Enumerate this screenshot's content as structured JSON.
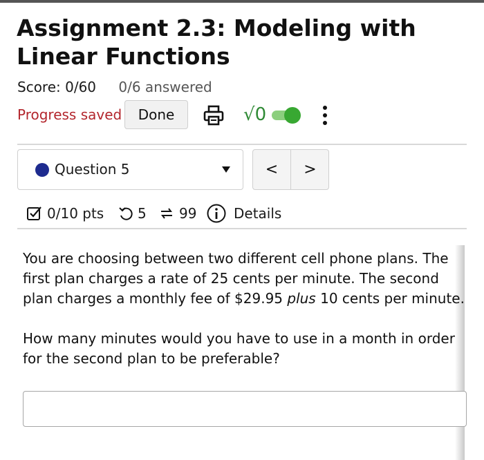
{
  "header": {
    "title": "Assignment 2.3: Modeling with Linear Functions",
    "score": "Score: 0/60",
    "answered": "0/6 answered"
  },
  "actions": {
    "progress_status": "Progress saved",
    "done_label": "Done",
    "print_icon": "printer-icon",
    "math_icon": "√0",
    "math_toggle_on": true,
    "accent_color": "#38a832",
    "more_icon": "kebab-menu-icon"
  },
  "question_nav": {
    "selected": "Question 5",
    "status_color": "#1e2b8f",
    "prev_label": "<",
    "next_label": ">"
  },
  "meta": {
    "points": "0/10 pts",
    "attempts": "5",
    "versions": "99",
    "details_label": "Details"
  },
  "question": {
    "paragraph1_a": "You are choosing between two different cell phone plans. The first plan charges a rate of 25 cents per minute. The second plan charges a monthly fee of $29.95 ",
    "paragraph1_em": "plus",
    "paragraph1_b": " 10 cents per minute.",
    "paragraph2": "How many minutes would you have to use in a month in order for the second plan to be preferable?",
    "answer_value": ""
  }
}
